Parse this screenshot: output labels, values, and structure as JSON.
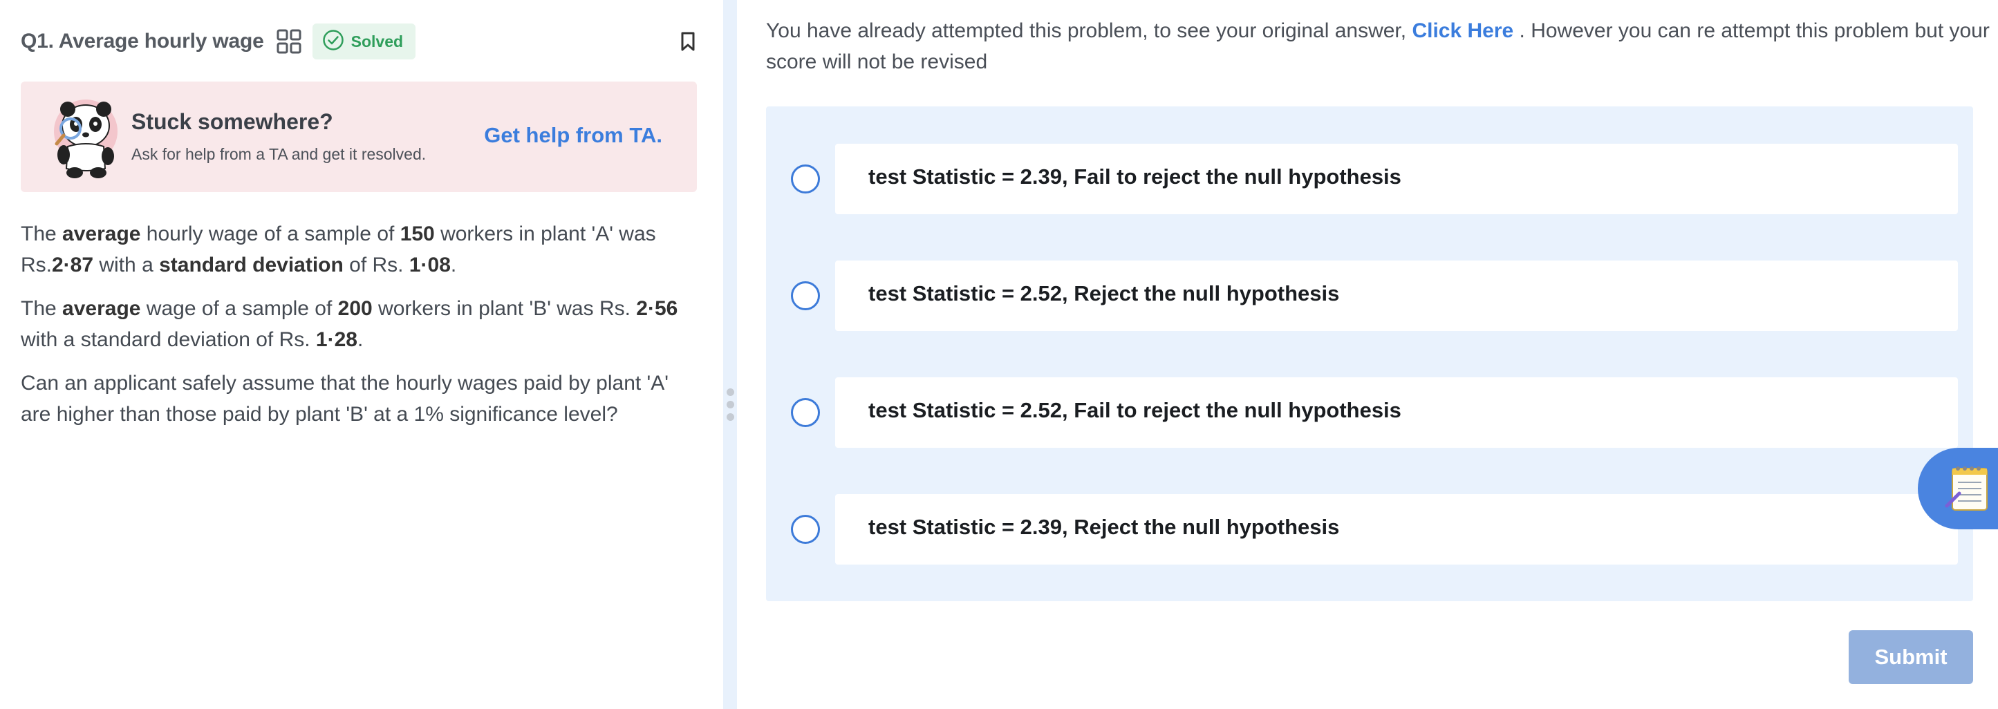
{
  "question": {
    "title": "Q1. Average hourly wage",
    "status_badge": "Solved"
  },
  "help_card": {
    "title": "Stuck somewhere?",
    "subtitle": "Ask for help from a TA and get it resolved.",
    "link": "Get help from TA."
  },
  "problem": {
    "p1": {
      "a": "The ",
      "b": "average",
      "c": " hourly wage of a sample of ",
      "d": "150",
      "e": " workers in plant 'A' was Rs.",
      "f": "2·87",
      "g": " with a ",
      "h": "standard deviation",
      "i": " of Rs. ",
      "j": "1·08",
      "k": "."
    },
    "p2": {
      "a": "The ",
      "b": "average",
      "c": " wage of a sample of ",
      "d": "200",
      "e": " workers in plant 'B' was Rs. ",
      "f": "2·56",
      "g": " with a standard deviation of Rs. ",
      "h": "1·28",
      "i": "."
    },
    "p3": "Can an applicant safely assume that the hourly wages paid by plant 'A' are higher than those paid by plant 'B' at a 1% significance level?"
  },
  "notice": {
    "before": "You have already attempted this problem, to see your original answer, ",
    "link": "Click Here",
    "after": " . However you can re attempt this problem but your score will not be revised"
  },
  "options": [
    "test Statistic = 2.39, Fail to reject the null hypothesis",
    "test Statistic = 2.52, Reject the null hypothesis",
    "test Statistic = 2.52, Fail to reject the null hypothesis",
    "test Statistic = 2.39, Reject the null hypothesis"
  ],
  "submit_label": "Submit",
  "icons": {
    "grid": "grid-icon",
    "solved": "check-circle-icon",
    "bookmark": "bookmark-icon",
    "mascot": "panda-mascot-icon",
    "notes": "notepad-icon",
    "drag": "drag-handle-icon"
  },
  "colors": {
    "accent": "#3b7ddd",
    "solved_bg": "#e7f5ec",
    "solved_fg": "#2f9e5b",
    "help_bg": "#f9e8ea",
    "options_bg": "#e9f2fd",
    "submit_disabled": "#93b1de"
  }
}
